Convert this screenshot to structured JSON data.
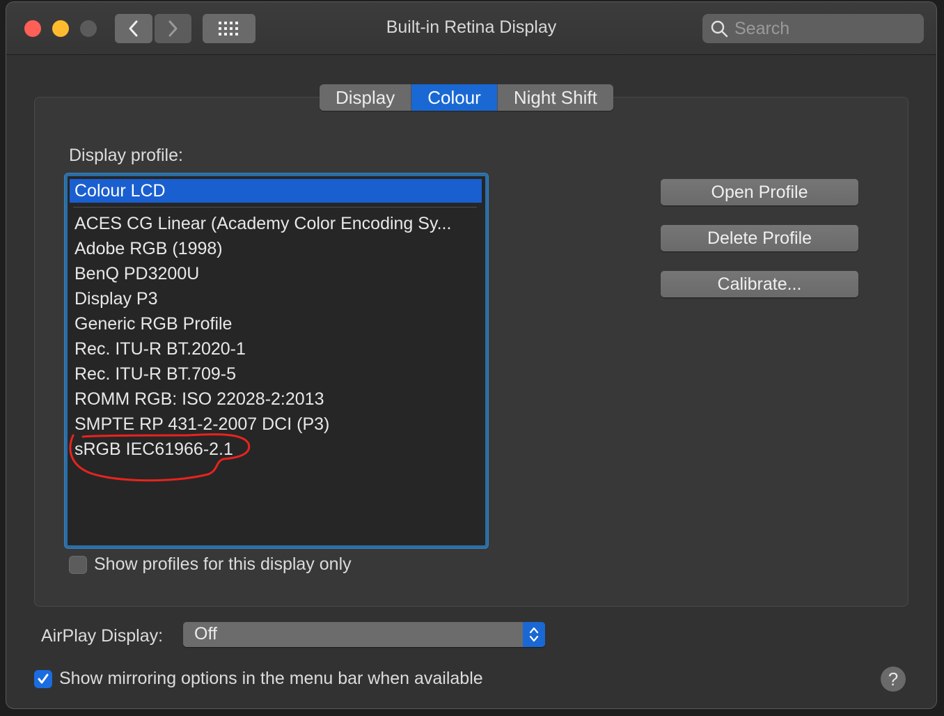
{
  "window": {
    "title": "Built-in Retina Display"
  },
  "search": {
    "placeholder": "Search"
  },
  "tabs": [
    {
      "label": "Display"
    },
    {
      "label": "Colour"
    },
    {
      "label": "Night Shift"
    }
  ],
  "active_tab": "Colour",
  "display_profile": {
    "label": "Display profile:",
    "selected": "Colour LCD",
    "items": [
      {
        "label": "Colour LCD"
      },
      {
        "label": "ACES CG Linear (Academy Color Encoding Sy..."
      },
      {
        "label": "Adobe RGB (1998)"
      },
      {
        "label": "BenQ PD3200U"
      },
      {
        "label": "Display P3"
      },
      {
        "label": "Generic RGB Profile"
      },
      {
        "label": "Rec. ITU-R BT.2020-1"
      },
      {
        "label": "Rec. ITU-R BT.709-5"
      },
      {
        "label": "ROMM RGB: ISO 22028-2:2013"
      },
      {
        "label": "SMPTE RP 431-2-2007 DCI (P3)"
      },
      {
        "label": "sRGB IEC61966-2.1"
      }
    ],
    "circled_item": "sRGB IEC61966-2.1"
  },
  "buttons": {
    "open_profile": "Open Profile",
    "delete_profile": "Delete Profile",
    "calibrate": "Calibrate..."
  },
  "show_profiles_checkbox": {
    "label": "Show profiles for this display only",
    "checked": false
  },
  "airplay": {
    "label": "AirPlay Display:",
    "value": "Off"
  },
  "mirroring_checkbox": {
    "label": "Show mirroring options in the menu bar when available",
    "checked": true
  },
  "help": {
    "label": "?"
  },
  "colors": {
    "accent": "#1a68d3",
    "annotation": "#e8231e"
  },
  "icons": {
    "back": "chevron-left-icon",
    "forward": "chevron-right-icon",
    "grid": "grid-icon",
    "search": "search-icon",
    "popup": "up-down-chevron-icon",
    "checkmark": "checkmark-icon"
  }
}
